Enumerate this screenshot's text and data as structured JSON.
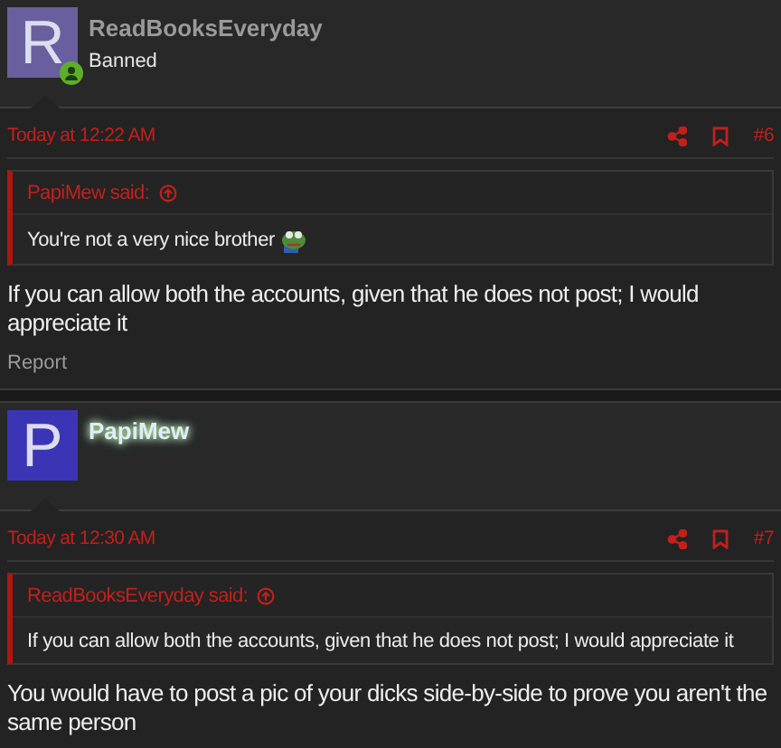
{
  "posts": [
    {
      "avatar": {
        "letter": "R",
        "color": "#6a5f9e",
        "online": true
      },
      "username": "ReadBooksEveryday",
      "username_glow": false,
      "user_title": "Banned",
      "timestamp": "Today at 12:22 AM",
      "post_number": "#6",
      "quote": {
        "author": "PapiMew said:",
        "text": "You're not a very nice brother",
        "emoji": true
      },
      "message": "If you can allow both the accounts, given that he does not post; I would appreciate it",
      "report": "Report"
    },
    {
      "avatar": {
        "letter": "P",
        "color": "#3b35b5"
      },
      "username": "PapiMew",
      "username_glow": true,
      "timestamp": "Today at 12:30 AM",
      "post_number": "#7",
      "quote": {
        "author": "ReadBooksEveryday said:",
        "text": "If you can allow both the accounts, given that he does not post; I would appreciate it"
      },
      "message": "You would have to post a pic of your dicks side-by-side to prove you aren't the same person"
    }
  ]
}
